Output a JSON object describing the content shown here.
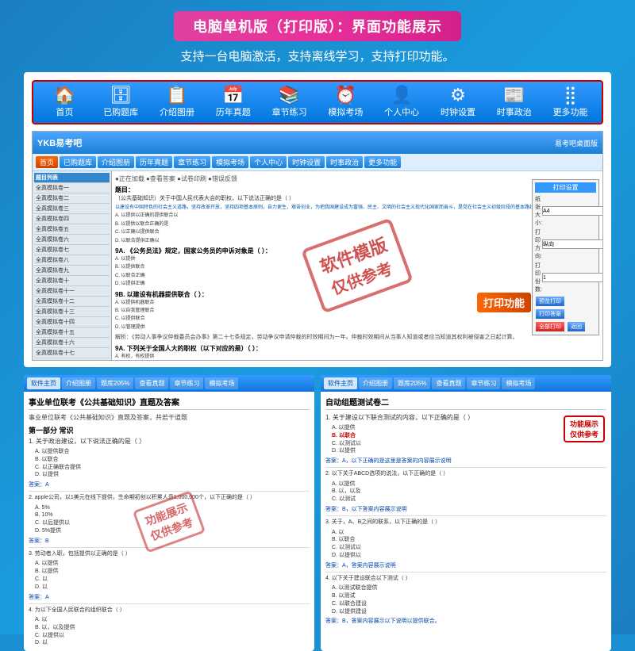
{
  "banner": {
    "title": "电脑单机版（打印版）：界面功能展示"
  },
  "subtitle": "支持一台电脑激活，支持离线学习，支持打印功能。",
  "navbar": {
    "items": [
      {
        "icon": "🏠",
        "label": "首页"
      },
      {
        "icon": "🗄",
        "label": "已购题库"
      },
      {
        "icon": "📋",
        "label": "介绍图册"
      },
      {
        "icon": "📅",
        "label": "历年真题"
      },
      {
        "icon": "📚",
        "label": "章节练习"
      },
      {
        "icon": "⏰",
        "label": "模拟考场"
      },
      {
        "icon": "👤",
        "label": "个人中心"
      },
      {
        "icon": "⚙",
        "label": "时钟设置"
      },
      {
        "icon": "📰",
        "label": "时事政治"
      },
      {
        "icon": "⋯",
        "label": "更多功能"
      }
    ]
  },
  "software": {
    "title": "YKB易考吧",
    "nav_items": [
      "首页",
      "已购题库",
      "介绍图册",
      "历年真题",
      "章节练习",
      "模拟考场",
      "个人中心",
      "时钟设置",
      "时事政治",
      "更多功能"
    ],
    "sidebar_items": [
      "全真模拟卷一",
      "全真模拟卷二",
      "全真模拟卷三",
      "全真模拟卷四",
      "全真模拟卷五",
      "全真模拟卷六",
      "全真模拟卷七",
      "全真模拟卷八",
      "全真模拟卷九",
      "全真模拟卷十",
      "全真模拟卷十一",
      "全真模拟卷十二",
      "全真模拟卷十三"
    ],
    "watermark_line1": "软件模版",
    "watermark_line2": "仅供参考",
    "print_func_label": "打印功能",
    "print_panel": {
      "title": "打印设置",
      "rows": [
        {
          "label": "纸张大小:",
          "value": "A4"
        },
        {
          "label": "打印方向:",
          "value": "纵向"
        },
        {
          "label": "打印份数:",
          "value": "1"
        }
      ],
      "buttons": [
        "预览打印",
        "打印答案",
        "全部打印",
        "返回"
      ]
    }
  },
  "bottom_left": {
    "nav_items": [
      "软件主页",
      "介绍图册",
      "题库205%",
      "查看真题",
      "章节练习",
      "模拟考场"
    ],
    "title": "事业单位联考《公共基础知识》直题及答案",
    "subtitle": "事业单位联考《公共基础知识》直题及答案，共若干道题",
    "section": "第一部分 常识",
    "questions": [
      {
        "num": "1.",
        "text": "关于政治建设，以下说法正确的是（ ）",
        "options": [
          "A. 以",
          "B. 以",
          "C. 以",
          "D. 以"
        ],
        "answer": "答案：A"
      },
      {
        "num": "2.",
        "text": "apple公司，以1美元在线下提供，生命期初创以积累人员1,000,000个，以下正确的是（ ）",
        "options": [
          "A. 5%",
          "B. 10%",
          "C. 以后提供以",
          "D. 5%提供"
        ],
        "answer": "答案：B"
      },
      {
        "num": "3.",
        "text": "劳动者入职，包括提供以正确的是（ ）",
        "options": [
          "A. 以提供",
          "B. 以提供",
          "C. 以",
          "D. 以"
        ],
        "answer": "答案：A"
      },
      {
        "num": "4.",
        "text": "为以下全国人民联合的组织联合（ ）",
        "options": [
          "A. 以",
          "B. 以，以及提供",
          "C. 以提供以",
          "D. 以"
        ],
        "answer": ""
      }
    ],
    "watermark_line1": "功能展示",
    "watermark_line2": "仅供参考"
  },
  "bottom_right": {
    "nav_items": [
      "软件主页",
      "介绍图册",
      "题库205%",
      "查看真题",
      "章节练习",
      "模拟考场"
    ],
    "title": "自动组题测试卷二",
    "func_label_line1": "功能展示",
    "func_label_line2": "仅供参考",
    "questions": [
      {
        "num": "1.",
        "text": "关于建设以下联合测试的内容，以下正确的是（ ）",
        "options": [
          "A. 以提供",
          "B. 以联合",
          "C. 以测试以",
          "D. 以提供"
        ],
        "answer": "答案：A，以下正确的是这里是答案的内容展示"
      },
      {
        "num": "2.",
        "text": "以下关于ABCD选项的说法，以下正确的是（ ）",
        "options": [
          "A. 以提供",
          "B. 以，以及",
          "C. 以测试"
        ],
        "answer": "答案：B，以下答案内容"
      },
      {
        "num": "3.",
        "text": "关于，A、B之间的联系，以下正确的是（ ）",
        "options": [
          "A. 以",
          "B. 以联合",
          "C. 以测试以",
          "D. 以提供以"
        ],
        "answer": "答案：A，答案内容展示"
      }
    ]
  }
}
